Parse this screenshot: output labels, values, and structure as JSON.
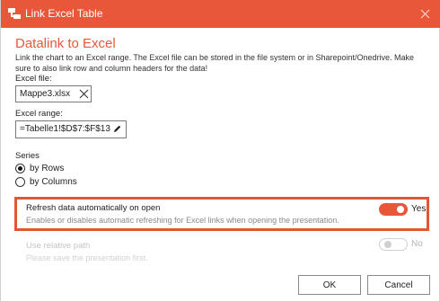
{
  "window": {
    "title": "Link Excel Table",
    "accent_color": "#e8573a"
  },
  "dialog": {
    "heading": "Datalink to Excel",
    "description": "Link the chart to an Excel range. The Excel file can be stored in the file system or in Sharepoint/Onedrive. Make sure to also link row and column headers for the data!",
    "excel_file": {
      "label": "Excel file:",
      "value": "Mappe3.xlsx"
    },
    "excel_range": {
      "label": "Excel range:",
      "value": "=Tabelle1!$D$7:$F$13"
    },
    "series": {
      "label": "Series",
      "options": [
        {
          "label": "by Rows",
          "selected": true
        },
        {
          "label": "by Columns",
          "selected": false
        }
      ]
    },
    "refresh": {
      "title": "Refresh data automatically on open",
      "description": "Enables or disables automatic refreshing for Excel links when opening the presentation.",
      "toggle_label": "Yes",
      "enabled": true
    },
    "relative_path": {
      "title": "Use relative path",
      "description": "Please save the presentation first.",
      "toggle_label": "No",
      "enabled": false,
      "disabled": true
    },
    "buttons": {
      "ok": "OK",
      "cancel": "Cancel"
    }
  }
}
